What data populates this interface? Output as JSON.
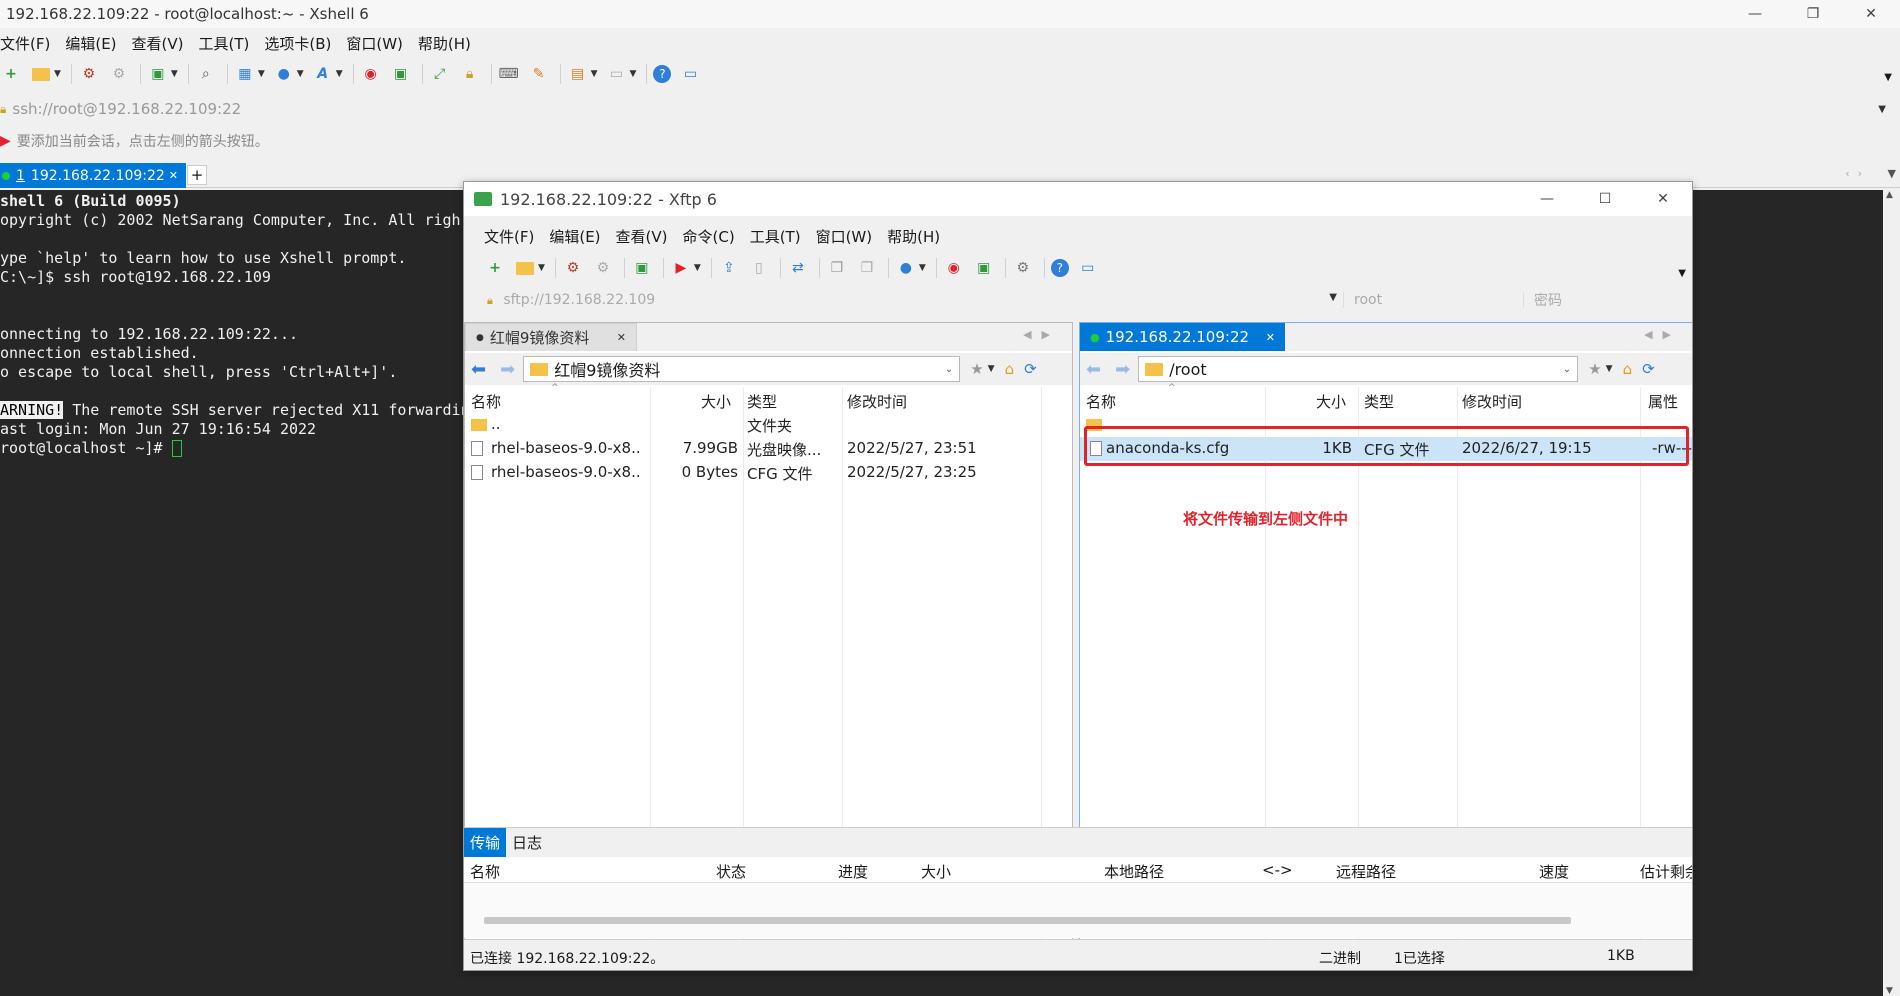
{
  "xshell": {
    "title": "192.168.22.109:22 - root@localhost:~ - Xshell 6",
    "menu": [
      "文件(F)",
      "编辑(E)",
      "查看(V)",
      "工具(T)",
      "选项卡(B)",
      "窗口(W)",
      "帮助(H)"
    ],
    "address": "ssh://root@192.168.22.109:22",
    "hint": "要添加当前会话，点击左侧的箭头按钮。",
    "tab": {
      "number": "1",
      "label": "192.168.22.109:22"
    },
    "terminal_lines": [
      "shell 6 (Build 0095)",
      "opyright (c) 2002 NetSarang Computer, Inc. All righ",
      "",
      "ype `help' to learn how to use Xshell prompt.",
      "C:\\~]$ ssh root@192.168.22.109",
      "",
      "",
      "onnecting to 192.168.22.109:22...",
      "onnection established.",
      "o escape to local shell, press 'Ctrl+Alt+]'.",
      ""
    ],
    "warning_tag": "ARNING!",
    "warning_text": " The remote SSH server rejected X11 forwardin",
    "last_login": "ast login: Mon Jun 27 19:16:54 2022",
    "prompt": "root@localhost ~]# "
  },
  "xftp": {
    "title": "192.168.22.109:22   - Xftp 6",
    "menu": [
      "文件(F)",
      "编辑(E)",
      "查看(V)",
      "命令(C)",
      "工具(T)",
      "窗口(W)",
      "帮助(H)"
    ],
    "address": {
      "url": "sftp://192.168.22.109",
      "user_placeholder": "root",
      "password_placeholder": "密码"
    },
    "left": {
      "tab": "红帽9镜像资料",
      "path": "红帽9镜像资料",
      "columns": [
        "名称",
        "大小",
        "类型",
        "修改时间"
      ],
      "rows": [
        {
          "name": "..",
          "size": "",
          "type": "文件夹",
          "modified": ""
        },
        {
          "name": "rhel-baseos-9.0-x8...",
          "size": "7.99GB",
          "type": "光盘映像...",
          "modified": "2022/5/27, 23:51"
        },
        {
          "name": "rhel-baseos-9.0-x8...",
          "size": "0 Bytes",
          "type": "CFG 文件",
          "modified": "2022/5/27, 23:25"
        }
      ]
    },
    "right": {
      "tab": "192.168.22.109:22",
      "path": "/root",
      "columns": [
        "名称",
        "大小",
        "类型",
        "修改时间",
        "属性"
      ],
      "rows": [
        {
          "name": "anaconda-ks.cfg",
          "size": "1KB",
          "type": "CFG 文件",
          "modified": "2022/6/27, 19:15",
          "attr": "-rw---"
        }
      ],
      "annotation": "将文件传输到左侧文件中"
    },
    "transfer": {
      "tabs": [
        "传输",
        "日志"
      ],
      "columns": [
        "名称",
        "状态",
        "进度",
        "大小",
        "本地路径",
        "<->",
        "远程路径",
        "速度",
        "估计剩余"
      ]
    },
    "status": {
      "connection": "已连接 192.168.22.109:22。",
      "mode": "二进制",
      "selection": "1已选择",
      "size": "1KB"
    }
  },
  "colors": {
    "accent": "#0078d7",
    "annotation_red": "#e3232c",
    "terminal_bg": "#262626",
    "connected_green": "#1fcf3a"
  }
}
